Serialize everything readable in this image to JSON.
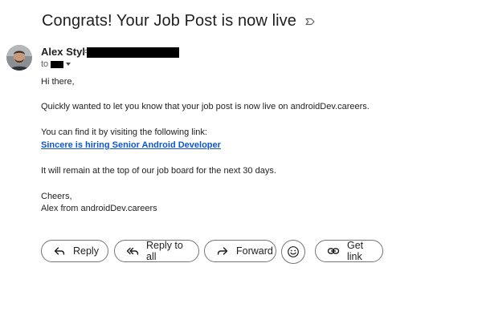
{
  "email": {
    "subject": "Congrats! Your Job Post is now live",
    "label_icon": "label-icon",
    "sender": {
      "name": "Alex Styl",
      "email_prefix": "<",
      "avatar_icon": "avatar"
    },
    "to_label": "to",
    "body": {
      "greeting": "Hi there,",
      "line1": "Quickly wanted to let you know that your job post is now live on androidDev.careers.",
      "line2": "You can find it by visiting the following link:",
      "link_text": "Sincere is hiring Senior Android Developer",
      "line3": "It will remain at the top of our job board for the next 30 days.",
      "signoff": "Cheers,",
      "signature": "Alex from androidDev.careers"
    }
  },
  "actions": {
    "reply_label": "Reply",
    "reply_all_label": "Reply to all",
    "forward_label": "Forward",
    "emoji_icon": "smiley-icon",
    "get_link_label": "Get link"
  },
  "colors": {
    "link": "#1155cc",
    "text": "#202124",
    "button_border": "#747775"
  }
}
